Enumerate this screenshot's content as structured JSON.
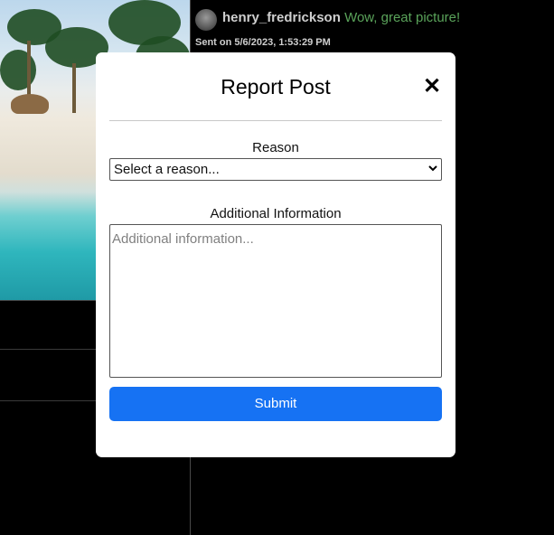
{
  "comment": {
    "username": "henry_fredrickson",
    "text": "Wow, great picture!",
    "sent": "Sent on 5/6/2023, 1:53:29 PM"
  },
  "modal": {
    "title": "Report Post",
    "close_symbol": "✕",
    "reason_label": "Reason",
    "reason_selected": "Select a reason...",
    "additional_label": "Additional Information",
    "additional_placeholder": "Additional information...",
    "submit_label": "Submit"
  },
  "colors": {
    "submit_bg": "#1672f3",
    "comment_text": "#5aa35a",
    "background": "#000000"
  },
  "icons": {
    "close": "close-icon",
    "dropdown": "chevron-down-icon",
    "avatar": "avatar"
  }
}
